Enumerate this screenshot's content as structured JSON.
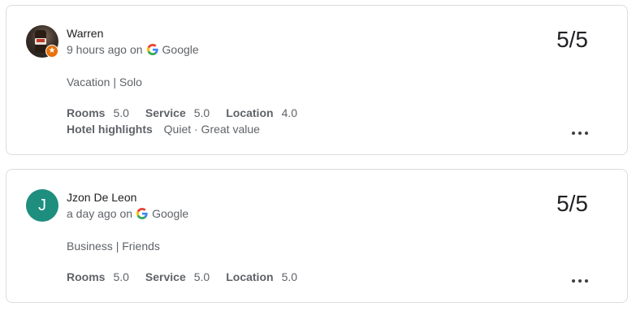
{
  "reviews": [
    {
      "reviewer": "Warren",
      "avatar": {
        "type": "photo",
        "badge_icon": "local-guide-star-icon",
        "badge_color": "#e8710a"
      },
      "time": "9 hours ago",
      "on_label": "on",
      "source": "Google",
      "score": "5/5",
      "trip": "Vacation | Solo",
      "ratings": [
        {
          "label": "Rooms",
          "value": "5.0"
        },
        {
          "label": "Service",
          "value": "5.0"
        },
        {
          "label": "Location",
          "value": "4.0"
        }
      ],
      "highlights_label": "Hotel highlights",
      "highlights": "Quiet · Great value",
      "more_icon": "more-horizontal-icon"
    },
    {
      "reviewer": "Jzon De Leon",
      "avatar": {
        "type": "letter",
        "letter": "J",
        "color": "#1e8e7e"
      },
      "time": "a day ago",
      "on_label": "on",
      "source": "Google",
      "score": "5/5",
      "trip": "Business | Friends",
      "ratings": [
        {
          "label": "Rooms",
          "value": "5.0"
        },
        {
          "label": "Service",
          "value": "5.0"
        },
        {
          "label": "Location",
          "value": "5.0"
        }
      ],
      "more_icon": "more-horizontal-icon"
    }
  ],
  "colors": {
    "text_primary": "#202124",
    "text_secondary": "#5f6368",
    "border": "#dadce0",
    "google_blue": "#4285f4",
    "google_red": "#ea4335",
    "google_yellow": "#fbbc05",
    "google_green": "#34a853"
  }
}
